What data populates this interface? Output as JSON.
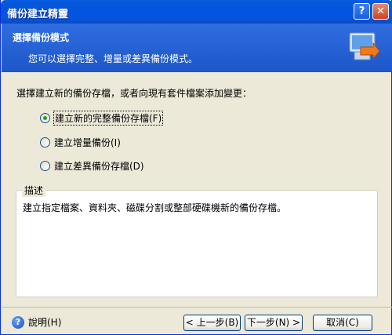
{
  "window": {
    "title": "備份建立精靈",
    "help_label": "?",
    "close_label": "✕"
  },
  "header": {
    "title": "選擇備份模式",
    "subtitle": "您可以選擇完整、增量或差異備份模式。"
  },
  "prompt": "選擇建立新的備份存檔，或者向現有套件檔案添加變更：",
  "options": [
    {
      "label": "建立新的完整備份存檔(F)",
      "selected": true
    },
    {
      "label": "建立增量備份(I)",
      "selected": false
    },
    {
      "label": "建立差異備份存檔(D)",
      "selected": false
    }
  ],
  "description": {
    "label": "描述",
    "text": "建立指定檔案、資料夾、磁碟分割或整部硬碟機新的備份存檔。"
  },
  "footer": {
    "help_label": "說明(H)",
    "back_label": "< 上一步(B)",
    "next_label": "下一步(N) >",
    "cancel_label": "取消(C)"
  },
  "colors": {
    "header_bg": "#2f6ee0",
    "title_bar": "#0454e4",
    "dialog_bg": "#ece9d8"
  }
}
